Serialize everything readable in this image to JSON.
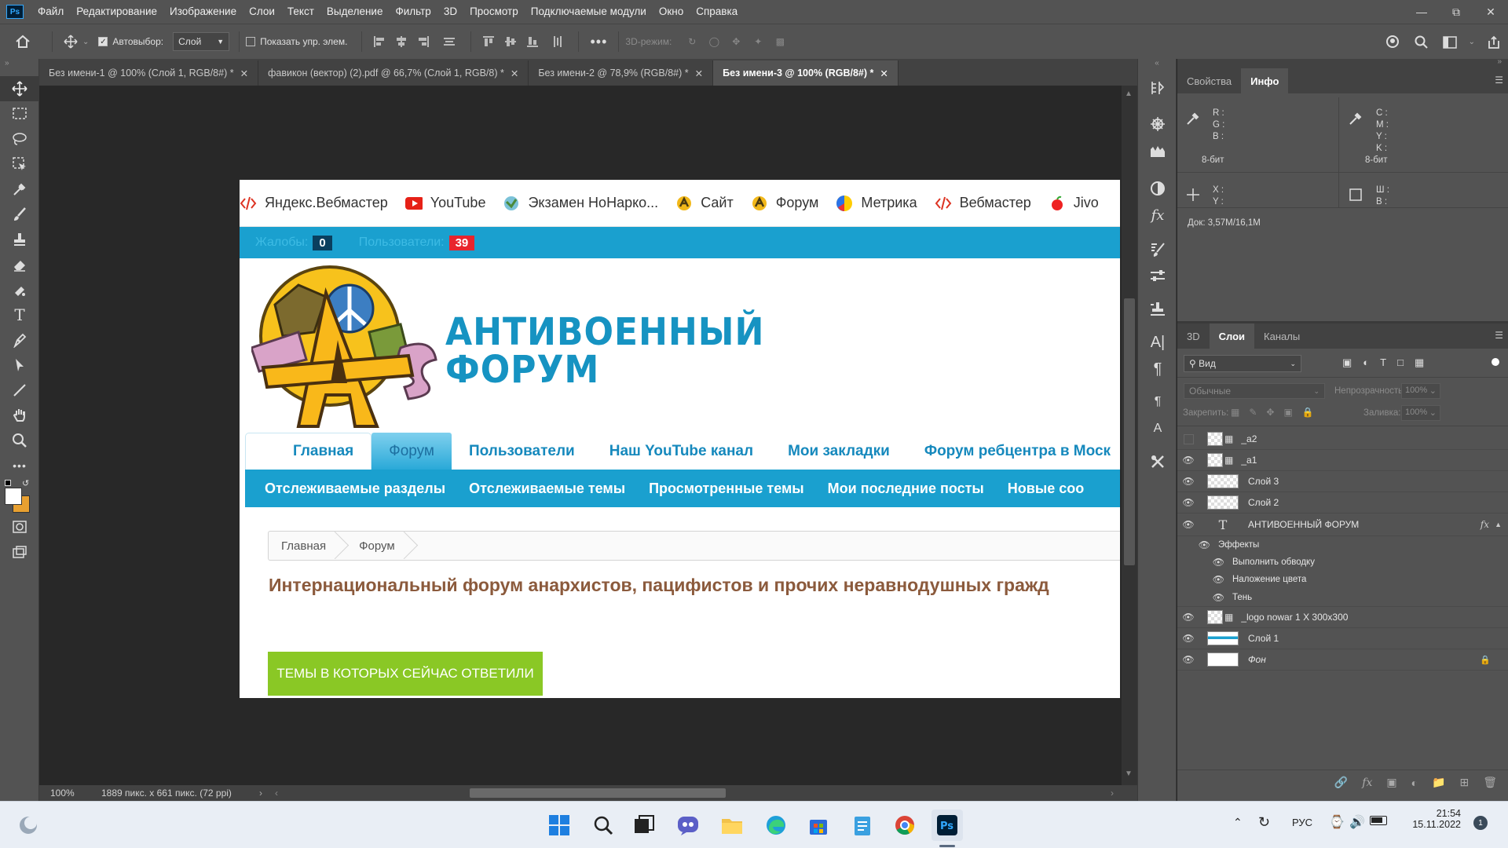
{
  "app": {
    "logo": "Ps"
  },
  "menu": [
    "Файл",
    "Редактирование",
    "Изображение",
    "Слои",
    "Текст",
    "Выделение",
    "Фильтр",
    "3D",
    "Просмотр",
    "Подключаемые модули",
    "Окно",
    "Справка"
  ],
  "options": {
    "autoselect_label": "Автовыбор:",
    "autoselect_value": "Слой",
    "show_controls": "Показать упр. элем.",
    "mode3d": "3D-режим:"
  },
  "tabs": [
    {
      "label": "Без имени-1 @ 100% (Слой 1, RGB/8#) *"
    },
    {
      "label": "фавикон (вектор) (2).pdf @ 66,7% (Слой 1, RGB/8) *"
    },
    {
      "label": "Без имени-2 @ 78,9% (RGB/8#) *"
    },
    {
      "label": "Без имени-3 @ 100% (RGB/8#) *"
    }
  ],
  "status": {
    "zoom": "100%",
    "size": "1889 пикс. x 661 пикс. (72 ppi)"
  },
  "document": {
    "bookmarks": [
      "Яндекс.Вебмастер",
      "YouTube",
      "Экзамен НоНарко...",
      "Сайт",
      "Форум",
      "Метрика",
      "Вебмастер",
      "Jivo"
    ],
    "bluebar": {
      "complaints_label": "Жалобы:",
      "complaints_count": "0",
      "users_label": "Пользователи:",
      "users_count": "39"
    },
    "title_line1": "АНТИВОЕННЫЙ",
    "title_line2": "ФОРУМ",
    "nav": [
      "Главная",
      "Форум",
      "Пользователи",
      "Наш YouTube канал",
      "Мои закладки",
      "Форум ребцентра в Моск"
    ],
    "subnav": [
      "Отслеживаемые разделы",
      "Отслеживаемые темы",
      "Просмотренные темы",
      "Мои последние посты",
      "Новые соо"
    ],
    "breadcrumb": [
      "Главная",
      "Форум"
    ],
    "tagline": "Интернациональный форум анархистов, пацифистов и прочих неравнодушных гражд",
    "green_button": "ТЕМЫ В КОТОРЫХ СЕЙЧАС ОТВЕТИЛИ"
  },
  "info_panel": {
    "tabs": [
      "Свойства",
      "Инфо"
    ],
    "rgb": [
      "R :",
      "G :",
      "B :"
    ],
    "cmyk": [
      "C :",
      "M :",
      "Y :",
      "K :"
    ],
    "bit1": "8-бит",
    "bit2": "8-бит",
    "xy": [
      "X :",
      "Y :"
    ],
    "wh": [
      "Ш :",
      "В :"
    ],
    "doc": "Док: 3,57M/16,1M"
  },
  "layers_panel": {
    "tabs": [
      "3D",
      "Слои",
      "Каналы"
    ],
    "filter": "Вид",
    "blend": "Обычные",
    "opacity_label": "Непрозрачность:",
    "opacity": "100%",
    "lock_label": "Закрепить:",
    "fill_label": "Заливка:",
    "fill": "100%",
    "layers": [
      {
        "name": "_a2",
        "visible": false
      },
      {
        "name": "_a1",
        "visible": true
      },
      {
        "name": "Слой 3",
        "visible": true
      },
      {
        "name": "Слой 2",
        "visible": true
      },
      {
        "name": "АНТИВОЕННЫЙ ФОРУМ",
        "visible": true,
        "type": "text"
      },
      {
        "name": "Эффекты",
        "visible": true,
        "indent": 1
      },
      {
        "name": "Выполнить обводку",
        "visible": true,
        "indent": 2
      },
      {
        "name": "Наложение цвета",
        "visible": true,
        "indent": 2
      },
      {
        "name": "Тень",
        "visible": true,
        "indent": 2
      },
      {
        "name": "_logo nowar 1 X 300x300",
        "visible": true
      },
      {
        "name": "Слой 1",
        "visible": true
      },
      {
        "name": "Фон",
        "visible": true,
        "italic": true,
        "locked": true
      }
    ]
  },
  "taskbar": {
    "lang": "РУС",
    "time": "21:54",
    "date": "15.11.2022",
    "notif": "1"
  },
  "colors": {
    "ps_bg": "#535353",
    "canvas_bg": "#282828",
    "forum_blue": "#1aa0cf",
    "green": "#8ac825",
    "tagline": "#8b5a3c"
  }
}
